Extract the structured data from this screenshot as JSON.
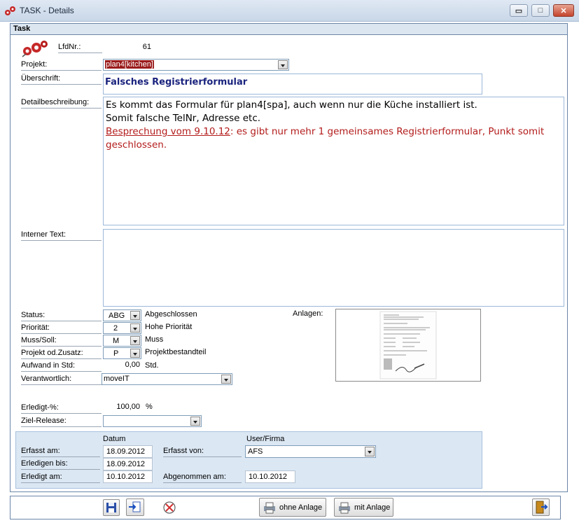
{
  "window": {
    "title": "TASK - Details",
    "min_label": "▭",
    "max_label": "□",
    "close_label": "✕"
  },
  "section": {
    "title": "Task"
  },
  "form": {
    "lfdnr_label": "LfdNr.:",
    "lfdnr_value": "61",
    "projekt_label": "Projekt:",
    "projekt_value": "plan4[kitchen]",
    "ueberschrift_label": "Überschrift:",
    "ueberschrift_value": "Falsches Registrierformular",
    "detail_label": "Detailbeschreibung:",
    "detail_lines": [
      "Es kommt das Formular für plan4[spa], auch wenn nur die Küche installiert ist.",
      "Somit falsche TelNr, Adresse etc."
    ],
    "detail_red_link": "Besprechung vom 9.10.12",
    "detail_red_rest": ": es gibt nur mehr 1 gemeinsames Registrierformular, Punkt somit geschlossen.",
    "intern_label": "Interner Text:",
    "intern_value": "",
    "status_label": "Status:",
    "status_code": "ABG",
    "status_text": "Abgeschlossen",
    "prio_label": "Priorität:",
    "prio_code": "2",
    "prio_text": "Hohe Priorität",
    "muss_label": "Muss/Soll:",
    "muss_code": "M",
    "muss_text": "Muss",
    "zusatz_label": "Projekt od.Zusatz:",
    "zusatz_code": "P",
    "zusatz_text": "Projektbestandteil",
    "aufwand_label": "Aufwand in Std:",
    "aufwand_value": "0,00",
    "aufwand_unit": "Std.",
    "verantw_label": "Verantwortlich:",
    "verantw_value": "moveIT",
    "anlagen_label": "Anlagen:",
    "erledigt_pct_label": "Erledigt-%:",
    "erledigt_pct_value": "100,00",
    "erledigt_pct_unit": "%",
    "ziel_label": "Ziel-Release:",
    "ziel_value": ""
  },
  "dates": {
    "datum_header": "Datum",
    "user_header": "User/Firma",
    "erfasst_am_label": "Erfasst am:",
    "erfasst_am_value": "18.09.2012",
    "erledigen_bis_label": "Erledigen bis:",
    "erledigen_bis_value": "18.09.2012",
    "erledigt_am_label": "Erledigt am:",
    "erledigt_am_value": "10.10.2012",
    "erfasst_von_label": "Erfasst von:",
    "erfasst_von_value": "AFS",
    "abgenommen_label": "Abgenommen am:",
    "abgenommen_value": "10.10.2012"
  },
  "toolbar": {
    "ohne_anlage": "ohne Anlage",
    "mit_anlage": "mit Anlage"
  }
}
